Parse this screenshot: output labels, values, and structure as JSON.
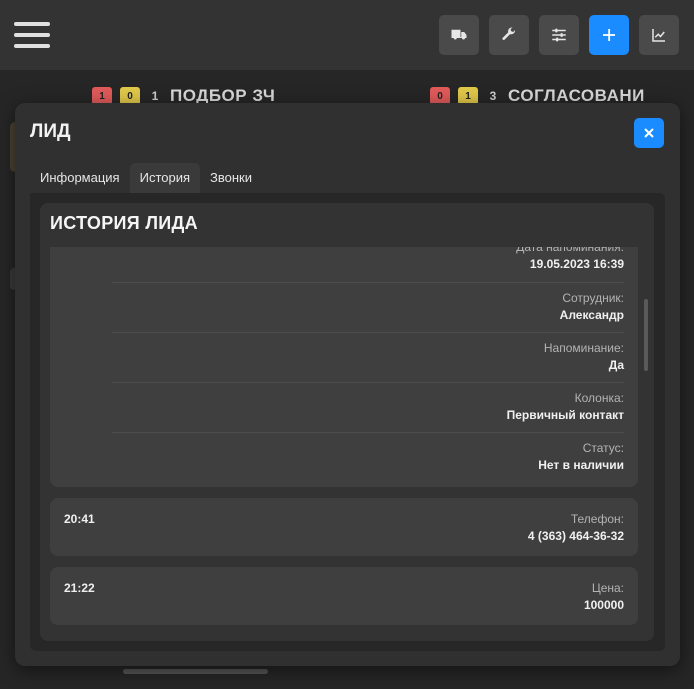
{
  "toolbar": {
    "buttons": [
      {
        "icon": "truck-icon"
      },
      {
        "icon": "wrench-icon"
      },
      {
        "icon": "sliders-icon"
      },
      {
        "icon": "plus-icon"
      },
      {
        "icon": "chart-icon"
      }
    ]
  },
  "board": {
    "columns": [
      {
        "badge_red": "1",
        "badge_yellow": "0",
        "count": "1",
        "title": "ПОДБОР ЗЧ"
      },
      {
        "badge_red": "0",
        "badge_yellow": "1",
        "count": "3",
        "title": "СОГЛАСОВАНИ"
      }
    ]
  },
  "modal": {
    "title": "ЛИД",
    "close_label": "×",
    "tabs": [
      "Информация",
      "История",
      "Звонки"
    ],
    "active_tab": "История",
    "section_title": "ИСТОРИЯ ЛИДА",
    "entries": [
      {
        "time": "",
        "fields": [
          {
            "label": "Дата напоминания:",
            "value": "19.05.2023 16:39"
          },
          {
            "label": "Сотрудник:",
            "value": "Александр"
          },
          {
            "label": "Напоминание:",
            "value": "Да"
          },
          {
            "label": "Колонка:",
            "value": "Первичный контакт"
          },
          {
            "label": "Статус:",
            "value": "Нет в наличии"
          }
        ]
      },
      {
        "time": "20:41",
        "fields": [
          {
            "label": "Телефон:",
            "value": "4 (363) 464-36-32"
          }
        ]
      },
      {
        "time": "21:22",
        "fields": [
          {
            "label": "Цена:",
            "value": "100000"
          }
        ]
      }
    ]
  },
  "colors": {
    "accent": "#1a8cff",
    "badge_red": "#e05a5a",
    "badge_yellow": "#e0c84a"
  }
}
